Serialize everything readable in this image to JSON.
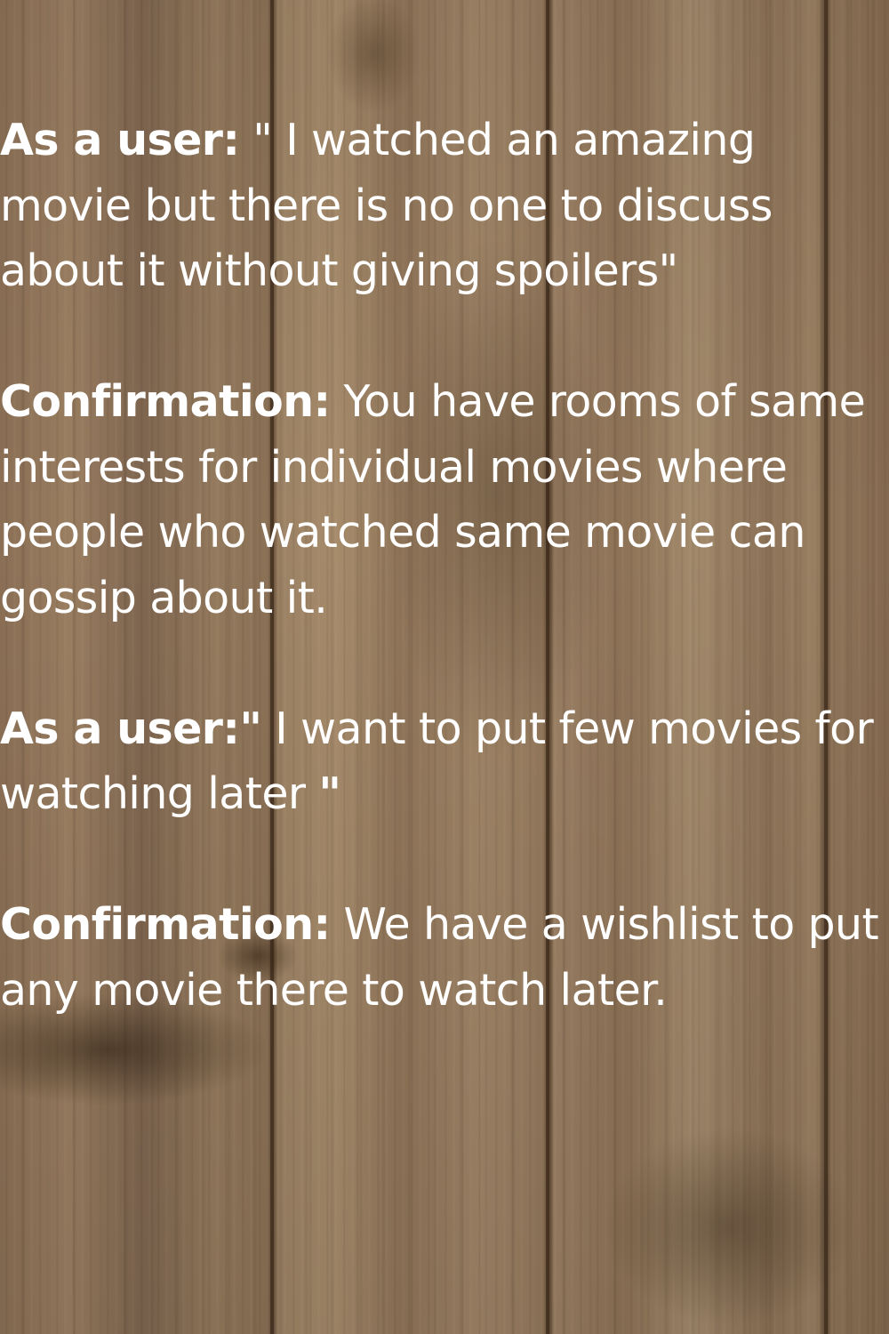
{
  "paragraphs": [
    {
      "label": "As a user:",
      "text": " \" I watched an amazing movie but there is no one to discuss about it without giving spoilers\"",
      "bold_end": ""
    },
    {
      "label": "Confirmation:",
      "text": " You have rooms of same interests for individual movies where people who watched same movie can gossip about it.",
      "bold_end": ""
    },
    {
      "label": "As a user:\"",
      "text": " I want to put few movies for watching later ",
      "bold_end": "\""
    },
    {
      "label": "Confirmation:",
      "text": " We have a wishlist to put any movie there to watch later.",
      "bold_end": ""
    }
  ],
  "colors": {
    "text": "#ffffff",
    "wood": "#947a5d"
  }
}
